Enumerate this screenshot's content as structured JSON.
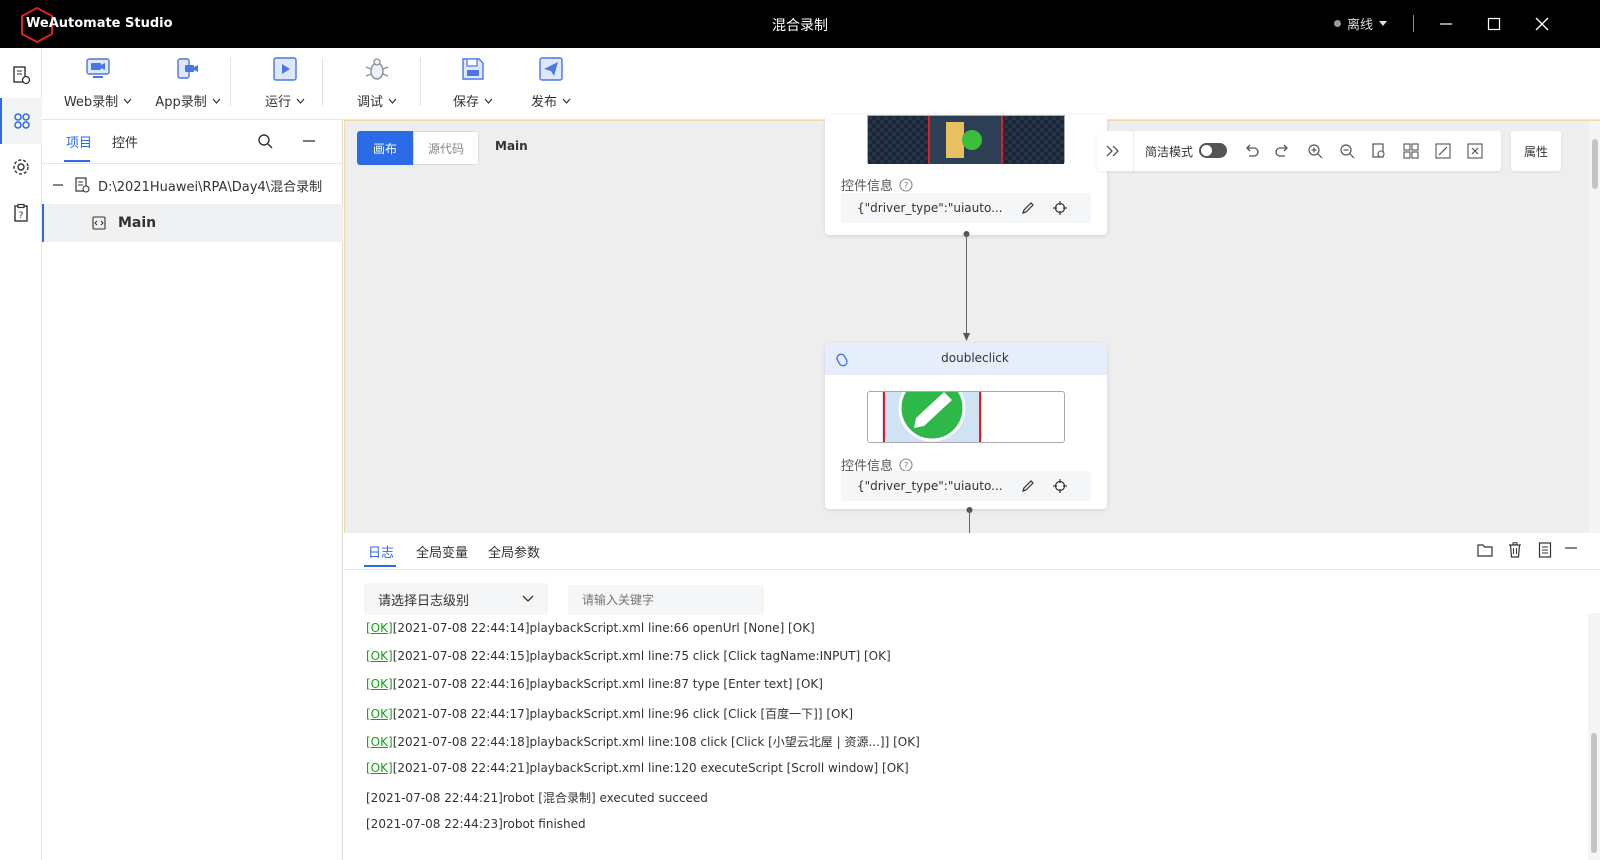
{
  "app": {
    "name": "WeAutomate Studio",
    "window_title": "混合录制",
    "status": "离线",
    "status_color": "#9a9a9a"
  },
  "toolbar": {
    "web_record": "Web录制",
    "app_record": "App录制",
    "run": "运行",
    "debug": "调试",
    "save": "保存",
    "publish": "发布"
  },
  "project_panel": {
    "tabs": [
      "项目",
      "控件"
    ],
    "active_tab": "项目",
    "root_path": "D:\\2021Huawei\\RPA\\Day4\\混合录制",
    "file": "Main"
  },
  "canvas": {
    "view_tabs": [
      "画布",
      "源代码"
    ],
    "active_view": "画布",
    "current_file": "Main",
    "simple_mode_label": "简洁模式",
    "simple_mode_on": false,
    "properties_label": "属性",
    "nodes": [
      {
        "title": "",
        "info_label": "控件信息",
        "info_value": "{\"driver_type\":\"uiauto..."
      },
      {
        "title": "doubleclick",
        "info_label": "控件信息",
        "info_value": "{\"driver_type\":\"uiauto..."
      }
    ]
  },
  "log_panel": {
    "tabs": [
      "日志",
      "全局变量",
      "全局参数"
    ],
    "active_tab": "日志",
    "level_placeholder": "请选择日志级别",
    "keyword_placeholder": "请输入关键字",
    "ok_tag": "[OK]",
    "ok_color": "#14a314",
    "lines": [
      {
        "ok": true,
        "text": "[2021-07-08 22:44:14]playbackScript.xml line:66 openUrl [None] [OK]"
      },
      {
        "ok": true,
        "text": "[2021-07-08 22:44:15]playbackScript.xml line:75 click [Click tagName:INPUT] [OK]"
      },
      {
        "ok": true,
        "text": "[2021-07-08 22:44:16]playbackScript.xml line:87 type [Enter text] [OK]"
      },
      {
        "ok": true,
        "text": "[2021-07-08 22:44:17]playbackScript.xml line:96 click [Click [百度一下]] [OK]"
      },
      {
        "ok": true,
        "text": "[2021-07-08 22:44:18]playbackScript.xml line:108 click [Click [小望云北屋 | 资源...]] [OK]"
      },
      {
        "ok": true,
        "text": "[2021-07-08 22:44:21]playbackScript.xml line:120 executeScript [Scroll window] [OK]"
      },
      {
        "ok": false,
        "text": "[2021-07-08 22:44:21]robot [混合录制] executed succeed"
      },
      {
        "ok": false,
        "text": "[2021-07-08 22:44:23]robot finished"
      }
    ]
  },
  "colors": {
    "accent": "#2b6be6",
    "titlebar": "#000000",
    "logo_red": "#e02020"
  }
}
